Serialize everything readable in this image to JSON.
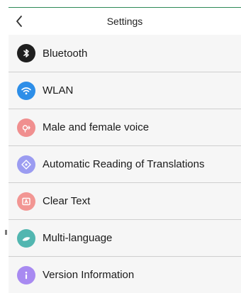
{
  "header": {
    "title": "Settings",
    "back_icon": "chevron-left-icon"
  },
  "items": [
    {
      "label": "Bluetooth",
      "icon": "bluetooth-icon",
      "color": "#1f1f1f"
    },
    {
      "label": "WLAN",
      "icon": "wifi-icon",
      "color": "#2d8ee8"
    },
    {
      "label": "Male and female voice",
      "icon": "voice-icon",
      "color": "#f08f8f"
    },
    {
      "label": "Automatic Reading of Translations",
      "icon": "translation-reading-icon",
      "color": "#9b9cf1"
    },
    {
      "label": "Clear Text",
      "icon": "clear-text-icon",
      "color": "#f29693"
    },
    {
      "label": "Multi-language",
      "icon": "multi-language-icon",
      "color": "#52b6b0"
    },
    {
      "label": "Version Information",
      "icon": "info-icon",
      "color": "#a88af1"
    }
  ],
  "colors": {
    "accent_line": "#2e8b57",
    "background": "#f6f6f6",
    "divider": "#cfcfcf"
  }
}
